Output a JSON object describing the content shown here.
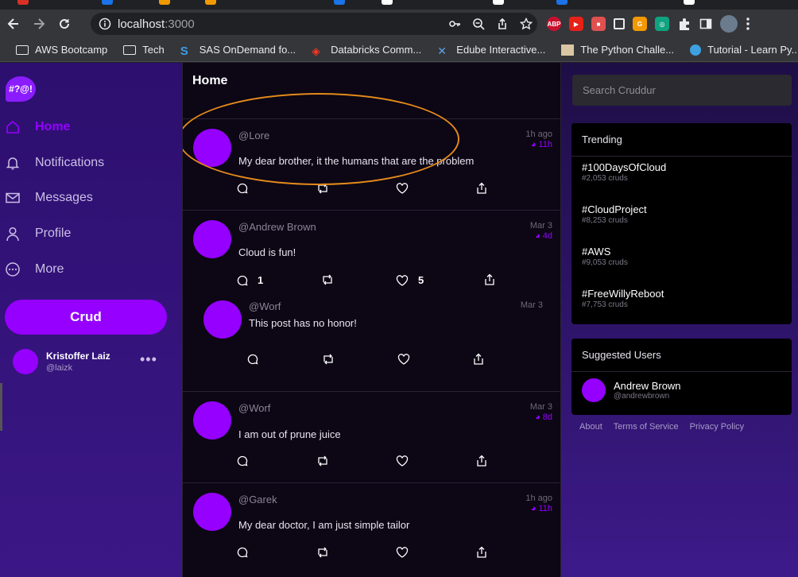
{
  "browser": {
    "url_host": "localhost",
    "url_port": ":3000",
    "bookmarks": [
      {
        "label": "AWS Bootcamp",
        "icon": "folder-icon"
      },
      {
        "label": "Tech",
        "icon": "folder-icon"
      },
      {
        "label": "SAS OnDemand fo...",
        "icon": "sas-icon"
      },
      {
        "label": "Databricks Comm...",
        "icon": "databricks-icon"
      },
      {
        "label": "Edube Interactive...",
        "icon": "edube-icon"
      },
      {
        "label": "The Python Challe...",
        "icon": "python-challenge-icon"
      },
      {
        "label": "Tutorial - Learn Py...",
        "icon": "learnpy-icon"
      }
    ],
    "more_bookmarks": "»",
    "extensions": [
      "ABP"
    ]
  },
  "sidebar": {
    "logo_text": "#?@!",
    "nav": [
      {
        "label": "Home",
        "icon": "home-icon",
        "active": true
      },
      {
        "label": "Notifications",
        "icon": "bell-icon",
        "active": false
      },
      {
        "label": "Messages",
        "icon": "envelope-icon",
        "active": false
      },
      {
        "label": "Profile",
        "icon": "person-icon",
        "active": false
      },
      {
        "label": "More",
        "icon": "more-circle-icon",
        "active": false
      }
    ],
    "crud_button": "Crud",
    "user": {
      "name": "Kristoffer Laiz",
      "handle": "@laizk",
      "more": "•••"
    }
  },
  "feed": {
    "title": "Home",
    "posts": [
      {
        "handle": "@Lore",
        "time": "1h ago",
        "expires": "11h",
        "message": "My dear brother, it the humans that are the problem",
        "replies": "",
        "likes": ""
      },
      {
        "handle": "@Andrew Brown",
        "time": "Mar 3",
        "expires": "4d",
        "message": "Cloud is fun!",
        "replies": "1",
        "likes": "5"
      },
      {
        "handle": "@Worf",
        "time": "Mar 3",
        "expires": "",
        "message": "This post has no honor!",
        "replies": "",
        "likes": ""
      },
      {
        "handle": "@Worf",
        "time": "Mar 3",
        "expires": "8d",
        "message": "I am out of prune juice",
        "replies": "",
        "likes": ""
      },
      {
        "handle": "@Garek",
        "time": "1h ago",
        "expires": "11h",
        "message": "My dear doctor, I am just simple tailor",
        "replies": "",
        "likes": ""
      }
    ]
  },
  "right": {
    "search_placeholder": "Search Cruddur",
    "trending_title": "Trending",
    "trending": [
      {
        "tag": "#100DaysOfCloud",
        "count": "#2,053 cruds"
      },
      {
        "tag": "#CloudProject",
        "count": "#8,253 cruds"
      },
      {
        "tag": "#AWS",
        "count": "#9,053 cruds"
      },
      {
        "tag": "#FreeWillyReboot",
        "count": "#7,753 cruds"
      }
    ],
    "suggested_title": "Suggested Users",
    "suggested": [
      {
        "name": "Andrew Brown",
        "handle": "@andrewbrown"
      }
    ],
    "footer": [
      "About",
      "Terms of Service",
      "Privacy Policy"
    ]
  },
  "colors": {
    "accent": "#9500ff",
    "annotation": "#e48a1a"
  }
}
